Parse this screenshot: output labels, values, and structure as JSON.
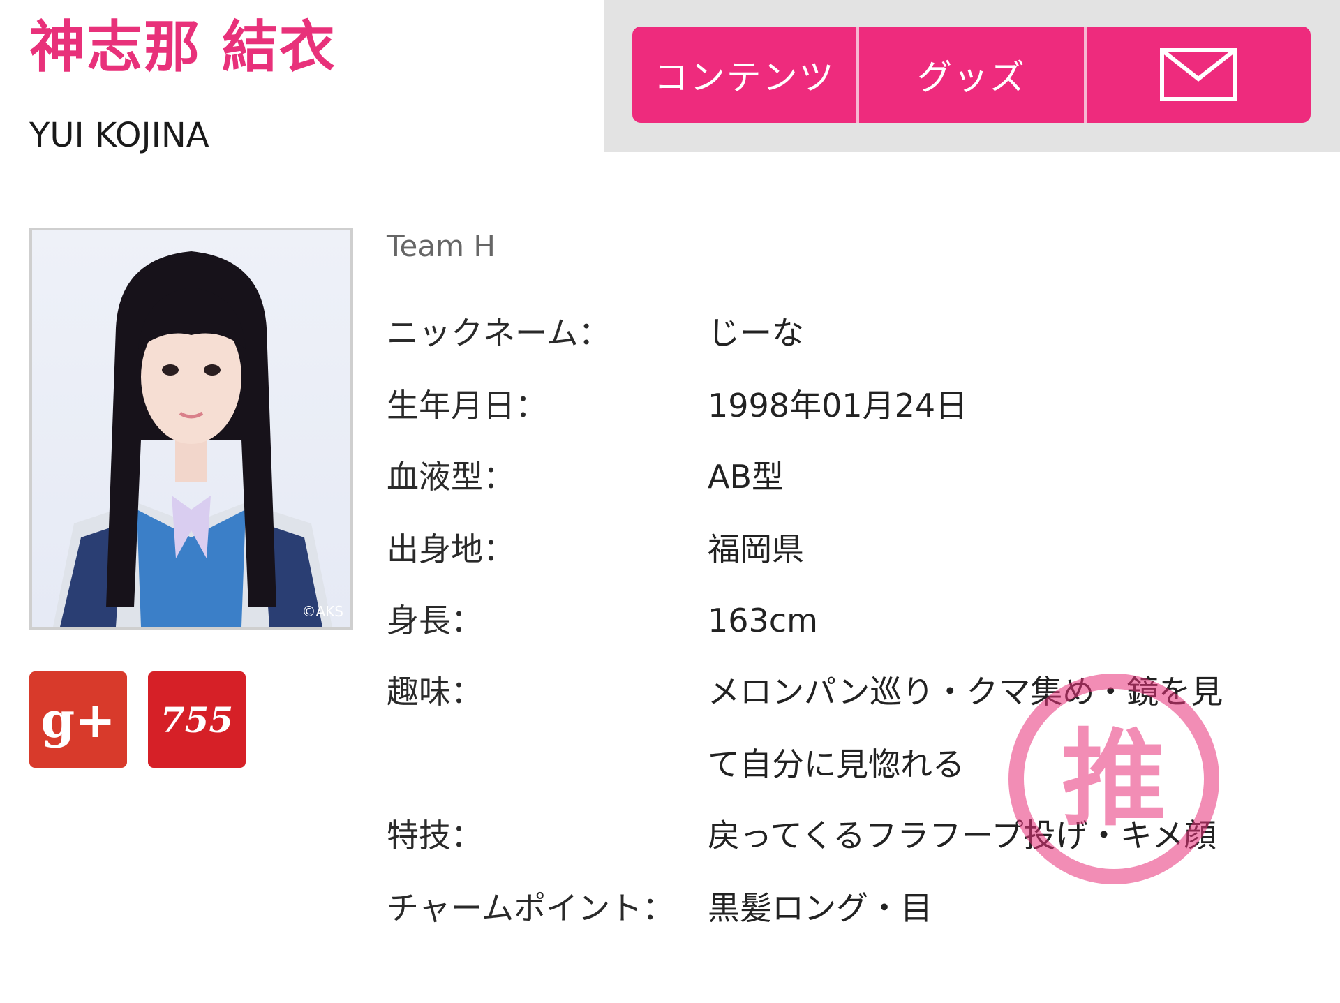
{
  "header": {
    "name_ja": "神志那 結衣",
    "name_en": "YUI KOJINA"
  },
  "nav": {
    "contents_label": "コンテンツ",
    "goods_label": "グッズ",
    "mail_icon": "mail-icon"
  },
  "photo": {
    "copyright": "©AKS"
  },
  "social": {
    "gplus_label": "g+",
    "s755_label": "755"
  },
  "profile": {
    "team": "Team H",
    "rows": [
      {
        "label": "ニックネーム：",
        "value": "じーな"
      },
      {
        "label": "生年月日：",
        "value": "1998年01月24日"
      },
      {
        "label": "血液型：",
        "value": "AB型"
      },
      {
        "label": "出身地：",
        "value": "福岡県"
      },
      {
        "label": "身長：",
        "value": "163cm"
      },
      {
        "label": "趣味：",
        "value": "メロンパン巡り・クマ集め・鏡を見",
        "value_cont": "て自分に見惚れる"
      },
      {
        "label": "特技：",
        "value": "戻ってくるフラフープ投げ・キメ顔"
      },
      {
        "label": "チャームポイント：",
        "value": "黒髪ロング・目"
      }
    ]
  },
  "stamp": {
    "text": "推"
  },
  "colors": {
    "accent": "#ee2b7d",
    "name": "#e8317a"
  }
}
